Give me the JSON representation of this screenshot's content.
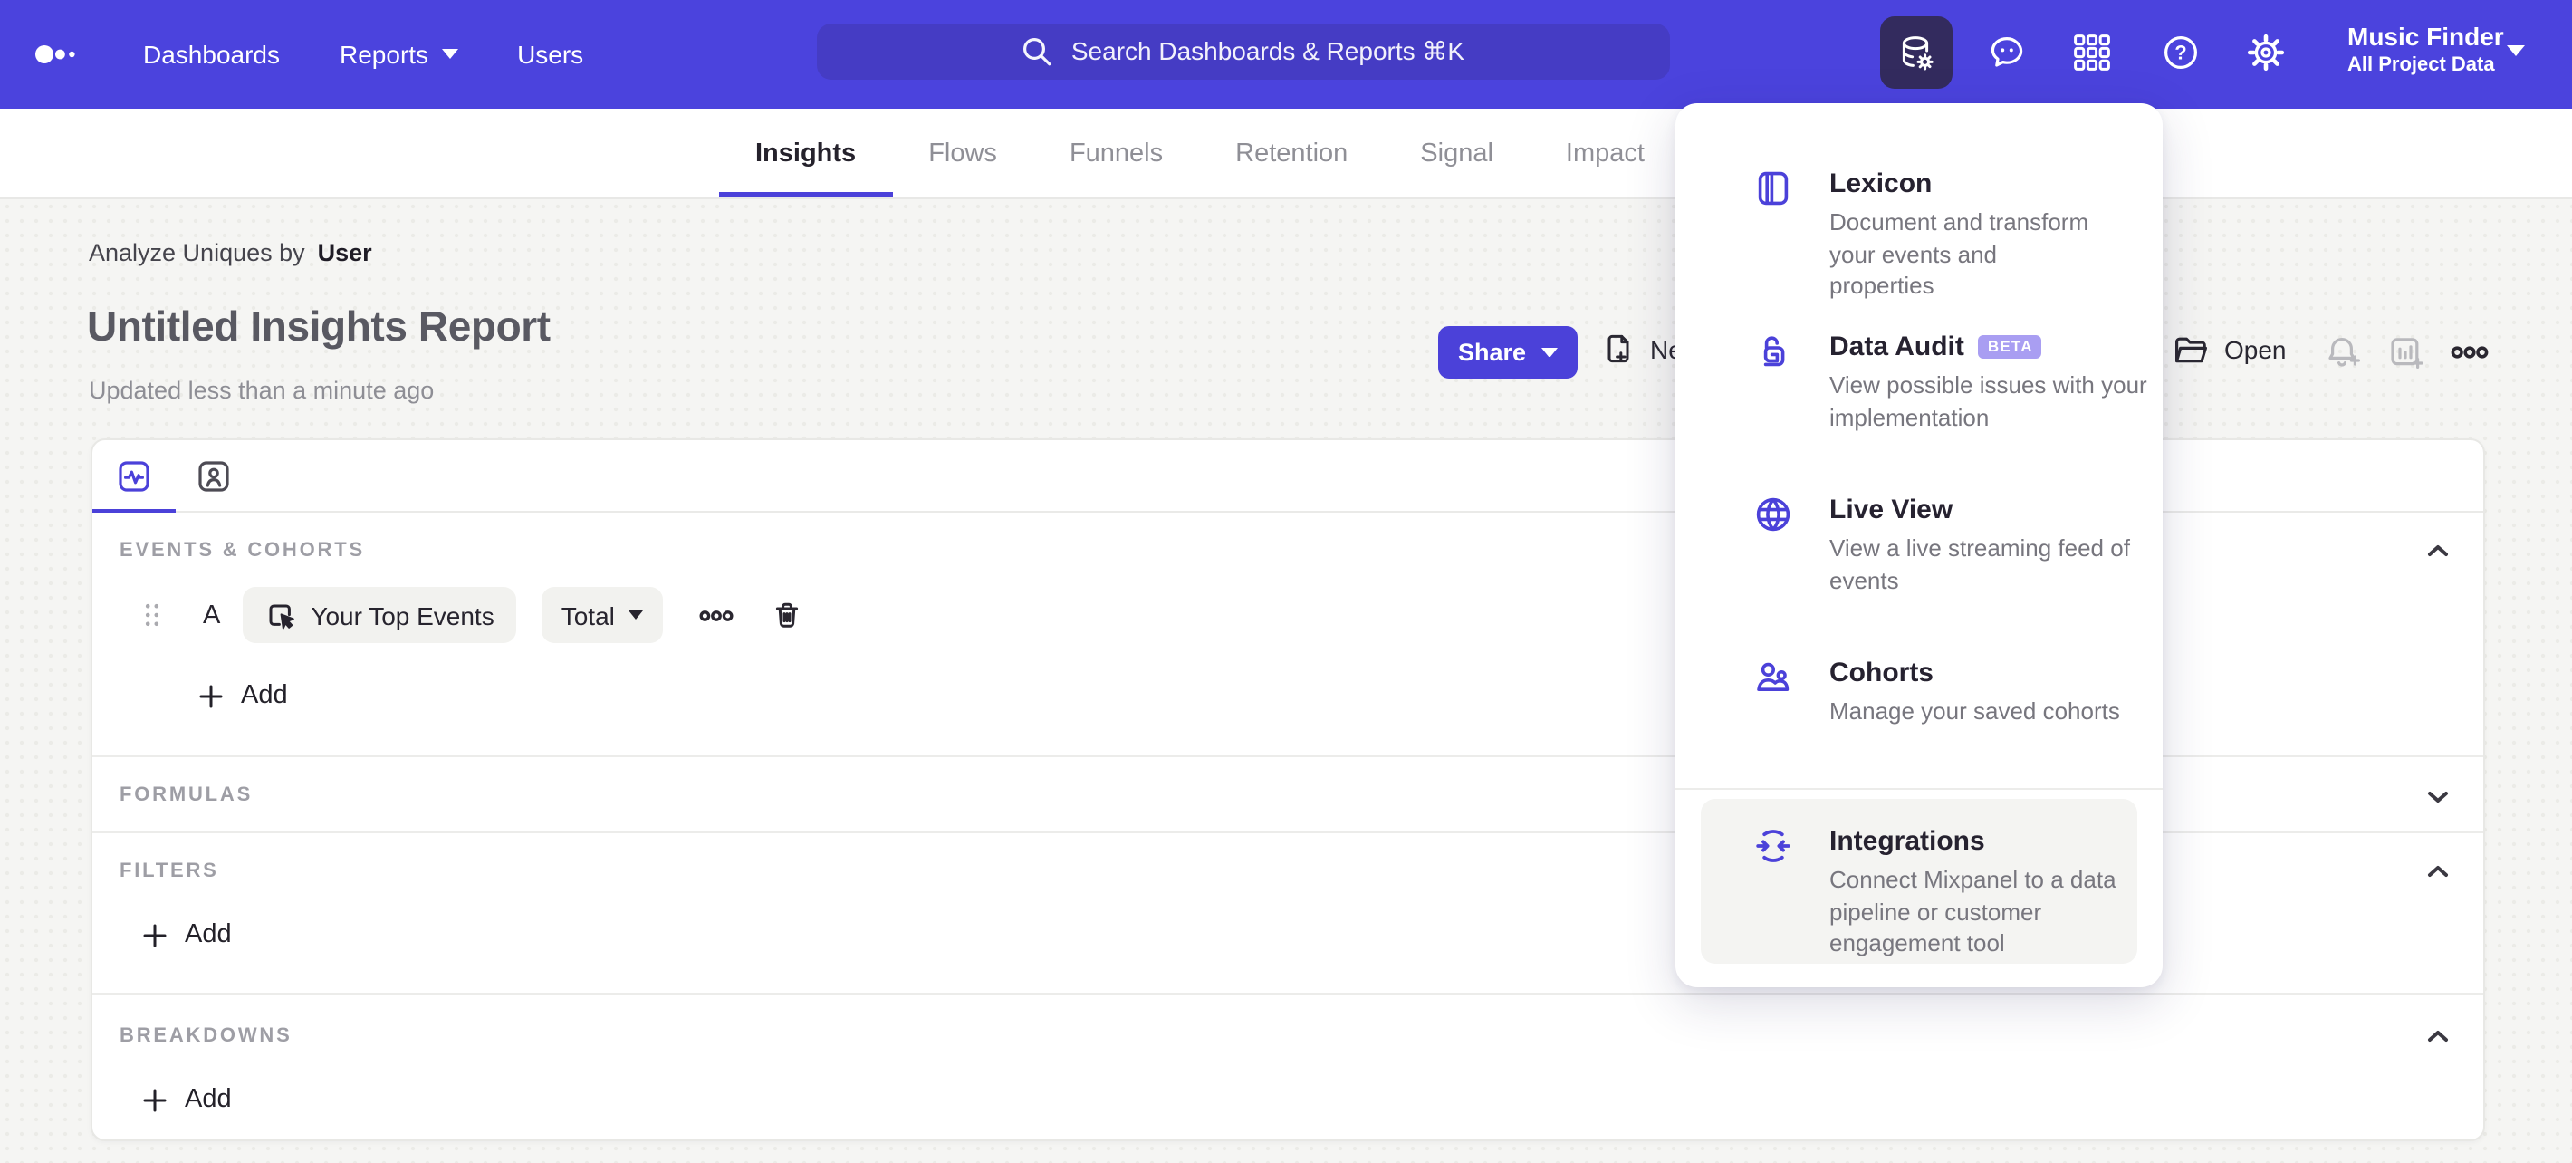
{
  "colors": {
    "accent": "#4b41d9",
    "nav_bg": "#4b43dd",
    "search_bg": "#453cc4",
    "active_icon_bg": "#332b5e",
    "badge_bg": "#a99ef2",
    "page_bg": "#f5f5f3",
    "highlight_bg": "#f4f4f2"
  },
  "nav": {
    "links": [
      "Dashboards",
      "Reports",
      "Users"
    ],
    "search_placeholder": "Search Dashboards & Reports ⌘K",
    "help_glyph": "?",
    "project_name": "Music Finder",
    "project_scope": "All Project Data"
  },
  "tabs": {
    "items": [
      "Insights",
      "Flows",
      "Funnels",
      "Retention",
      "Signal",
      "Impact"
    ],
    "active": "Insights"
  },
  "report": {
    "analyze_prefix": "Analyze Uniques by",
    "analyze_value": "User",
    "title": "Untitled Insights Report",
    "updated": "Updated less than a minute ago"
  },
  "actions": {
    "share": "Share",
    "new": "New",
    "open": "Open"
  },
  "builder": {
    "events_label": "EVENTS & COHORTS",
    "formulas_label": "FORMULAS",
    "filters_label": "FILTERS",
    "breakdowns_label": "BREAKDOWNS",
    "add_label": "Add",
    "row": {
      "letter": "A",
      "event": "Your Top Events",
      "metric": "Total"
    }
  },
  "menu": {
    "items": [
      {
        "title": "Lexicon",
        "desc": "Document and transform your events and properties"
      },
      {
        "title": "Data Audit",
        "badge": "BETA",
        "desc": "View possible issues with your implementation"
      },
      {
        "title": "Live View",
        "desc": "View a live streaming feed of events"
      },
      {
        "title": "Cohorts",
        "desc": "Manage your saved cohorts"
      },
      {
        "title": "Integrations",
        "desc": "Connect Mixpanel to a data pipeline or customer engagement tool"
      }
    ]
  }
}
